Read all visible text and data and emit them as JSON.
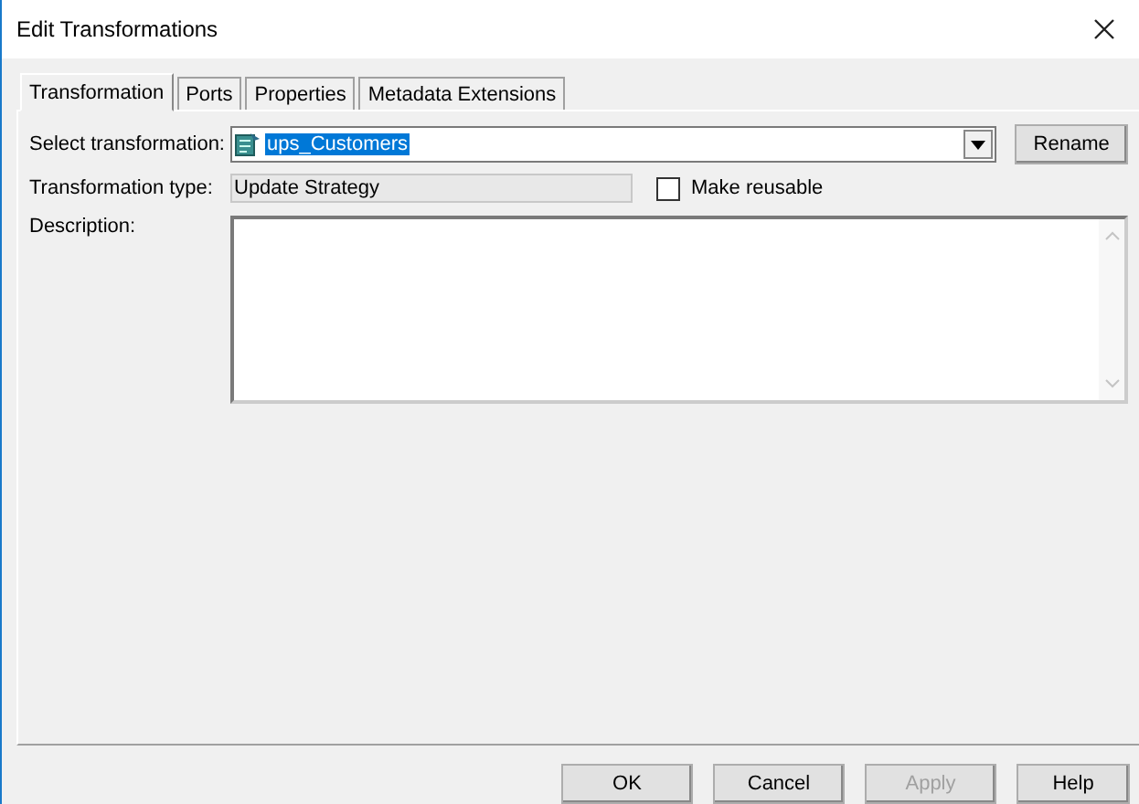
{
  "window": {
    "title": "Edit Transformations"
  },
  "tabs": [
    {
      "label": "Transformation",
      "selected": true
    },
    {
      "label": "Ports",
      "selected": false
    },
    {
      "label": "Properties",
      "selected": false
    },
    {
      "label": "Metadata Extensions",
      "selected": false
    }
  ],
  "select_transformation": {
    "label": "Select transformation:",
    "value": "ups_Customers"
  },
  "rename_button": "Rename",
  "transformation_type": {
    "label": "Transformation type:",
    "value": "Update Strategy"
  },
  "make_reusable": {
    "label": "Make reusable",
    "checked": false
  },
  "description": {
    "label": "Description:"
  },
  "buttons": [
    {
      "label": "OK",
      "disabled": false
    },
    {
      "label": "Cancel",
      "disabled": false
    },
    {
      "label": "Apply",
      "disabled": true
    },
    {
      "label": "Help",
      "disabled": false
    }
  ]
}
